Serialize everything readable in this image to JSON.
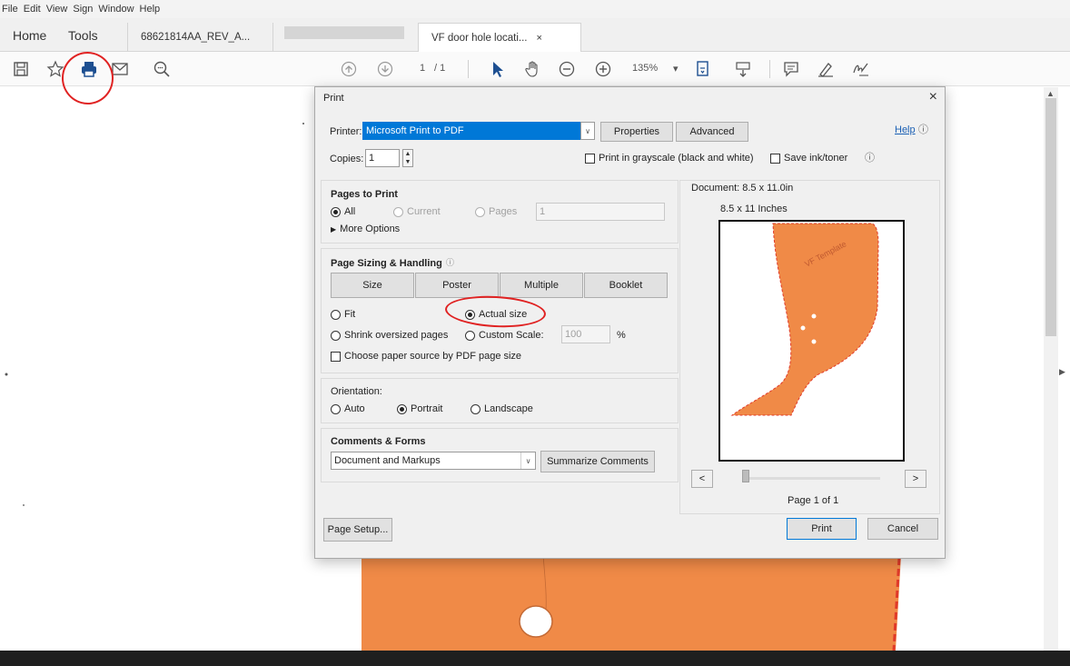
{
  "menu": [
    "File",
    "Edit",
    "View",
    "Sign",
    "Window",
    "Help"
  ],
  "tabs": {
    "home": "Home",
    "tools": "Tools",
    "doc1": "68621814AA_REV_A...",
    "doc3": "VF door hole locati...",
    "close": "×"
  },
  "toolbar": {
    "page_current": "1",
    "page_total": "/ 1",
    "zoom": "135%",
    "zoom_arrow": "▾"
  },
  "dialog": {
    "title": "Print",
    "close": "×",
    "printer_label": "Printer:",
    "printer_value": "Microsoft Print to PDF",
    "properties": "Properties",
    "advanced": "Advanced",
    "help": "Help",
    "copies_label": "Copies:",
    "copies_value": "1",
    "grayscale": "Print in grayscale (black and white)",
    "save_ink": "Save ink/toner",
    "pages_to_print": {
      "title": "Pages to Print",
      "all": "All",
      "current": "Current",
      "pages": "Pages",
      "pages_value": "1",
      "more_options": "More Options"
    },
    "sizing": {
      "title": "Page Sizing & Handling",
      "size": "Size",
      "poster": "Poster",
      "multiple": "Multiple",
      "booklet": "Booklet",
      "fit": "Fit",
      "actual_size": "Actual size",
      "shrink": "Shrink oversized pages",
      "custom_scale": "Custom Scale:",
      "scale_value": "100",
      "percent": "%",
      "paper_source": "Choose paper source by PDF page size"
    },
    "orientation": {
      "title": "Orientation:",
      "auto": "Auto",
      "portrait": "Portrait",
      "landscape": "Landscape"
    },
    "comments": {
      "title": "Comments & Forms",
      "value": "Document and Markups",
      "summarize": "Summarize Comments"
    },
    "preview": {
      "document": "Document: 8.5 x 11.0in",
      "paper": "8.5 x 11 Inches",
      "page_of": "Page 1 of 1",
      "prev": "<",
      "next": ">",
      "sheet_text": "VF Template"
    },
    "page_setup": "Page Setup...",
    "print": "Print",
    "cancel": "Cancel"
  },
  "colors": {
    "part_orange": "#f08a47",
    "annotation_red": "#e02222",
    "printer_highlight": "#0078d7"
  }
}
